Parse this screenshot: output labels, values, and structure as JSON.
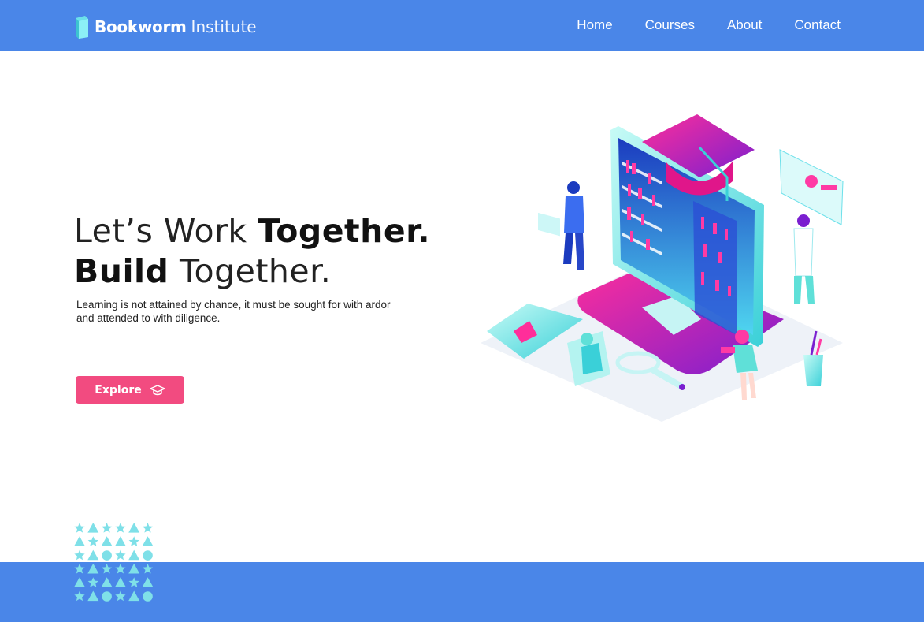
{
  "brand": {
    "bold": "Bookworm",
    "light": "Institute"
  },
  "nav": {
    "items": [
      "Home",
      "Courses",
      "About",
      "Contact"
    ]
  },
  "hero": {
    "line1_light": "Let’s Work ",
    "line1_bold": "Together.",
    "line2_bold": "Build",
    "line2_light": " Together.",
    "subtext": "Learning is not attained by chance, it must be sought for with ardor and attended to with diligence.",
    "button_label": "Explore"
  },
  "colors": {
    "header": "#4a86e8",
    "footer": "#4a86e8",
    "button": "#f24b80",
    "pattern": "#7fe0e8"
  },
  "icons": {
    "logo": "book-icon",
    "button": "graduation-cap-icon"
  }
}
